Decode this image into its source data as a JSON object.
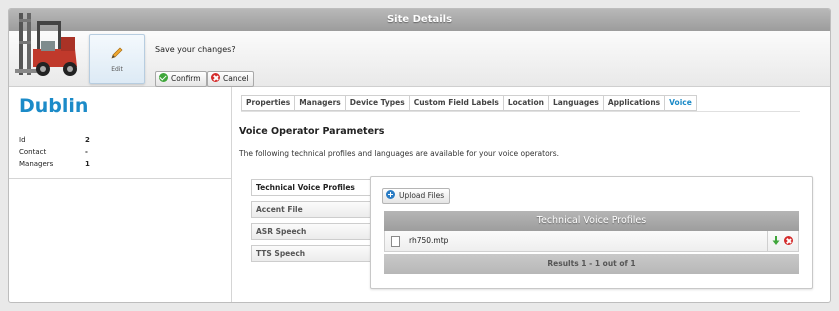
{
  "window": {
    "title": "Site Details"
  },
  "toolbar": {
    "edit_label": "Edit",
    "save_prompt": "Save your changes?",
    "confirm_label": "Confirm",
    "cancel_label": "Cancel"
  },
  "site": {
    "name": "Dublin",
    "info": [
      {
        "label": "Id",
        "value": "2"
      },
      {
        "label": "Contact",
        "value": "-"
      },
      {
        "label": "Managers",
        "value": "1"
      }
    ]
  },
  "tabs": [
    {
      "label": "Properties"
    },
    {
      "label": "Managers"
    },
    {
      "label": "Device Types"
    },
    {
      "label": "Custom Field Labels"
    },
    {
      "label": "Location"
    },
    {
      "label": "Languages"
    },
    {
      "label": "Applications"
    },
    {
      "label": "Voice",
      "active": true
    }
  ],
  "voice": {
    "title": "Voice Operator Parameters",
    "description": "The following technical profiles and languages are available for your voice operators.",
    "sub_tabs": [
      {
        "label": "Technical Voice Profiles",
        "active": true
      },
      {
        "label": "Accent File"
      },
      {
        "label": "ASR Speech"
      },
      {
        "label": "TTS Speech"
      }
    ],
    "upload_label": "Upload Files",
    "grid": {
      "title": "Technical Voice Profiles",
      "rows": [
        {
          "file": "rh750.mtp"
        }
      ],
      "footer": "Results 1 - 1 out of 1"
    }
  },
  "colors": {
    "accent": "#1c8bc8",
    "confirm": "#3fa63b",
    "cancel": "#d42b2b"
  }
}
